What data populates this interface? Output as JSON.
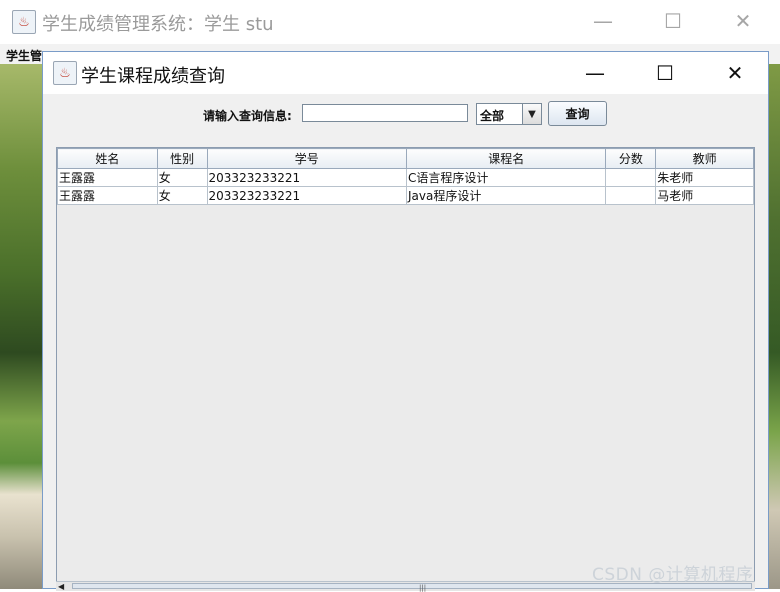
{
  "outer_window": {
    "title": "学生成绩管理系统：学生 stu",
    "menubar_text": "学生管"
  },
  "inner_window": {
    "title": "学生课程成绩查询"
  },
  "query": {
    "label": "请输入查询信息:",
    "input_value": "",
    "combo_value": "全部",
    "button_label": "查询"
  },
  "table": {
    "headers": [
      "姓名",
      "性别",
      "学号",
      "课程名",
      "分数",
      "教师"
    ],
    "rows": [
      [
        "王露露",
        "女",
        "203323233221",
        "C语言程序设计",
        "",
        "朱老师"
      ],
      [
        "王露露",
        "女",
        "203323233221",
        "Java程序设计",
        "",
        "马老师"
      ]
    ]
  },
  "watermark": "CSDN @计算机程序"
}
